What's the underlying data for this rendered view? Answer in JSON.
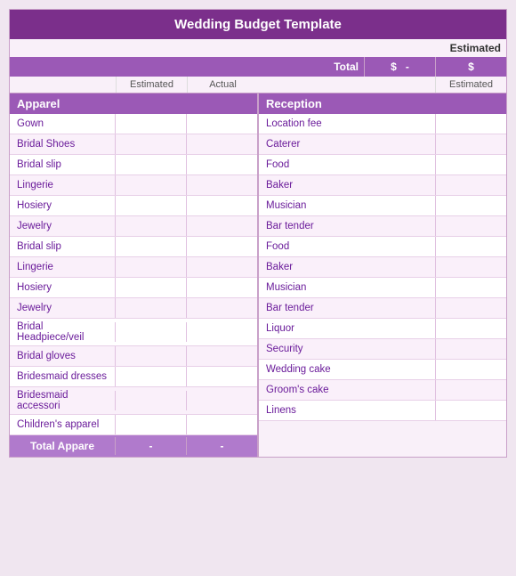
{
  "title": "Wedding Budget Template",
  "estimated_label": "Estimated",
  "total_label": "Total",
  "currency_symbol": "$",
  "dash": "-",
  "col_headers": {
    "estimated": "Estimated",
    "actual": "Actual",
    "estimated2": "Estimated"
  },
  "left_section": {
    "header": "Apparel",
    "rows": [
      "Gown",
      "Bridal Shoes",
      "Bridal slip",
      "Lingerie",
      "Hosiery",
      "Jewelry",
      "Bridal slip",
      "Lingerie",
      "Hosiery",
      "Jewelry",
      "Bridal Headpiece/veil",
      "Bridal gloves",
      "Bridesmaid dresses",
      "Bridesmaid accessori",
      "Children's apparel"
    ],
    "footer_label": "Total Appare",
    "footer_val1": "-",
    "footer_val2": "-"
  },
  "right_section": {
    "header": "Reception",
    "rows": [
      "Location fee",
      "Caterer",
      "Food",
      "Baker",
      "Musician",
      "Bar tender",
      "Food",
      "Baker",
      "Musician",
      "Bar tender",
      "Liquor",
      "Security",
      "Wedding cake",
      "Groom's cake",
      "Linens"
    ],
    "footer_label": "",
    "footer_val1": "",
    "footer_val2": ""
  }
}
